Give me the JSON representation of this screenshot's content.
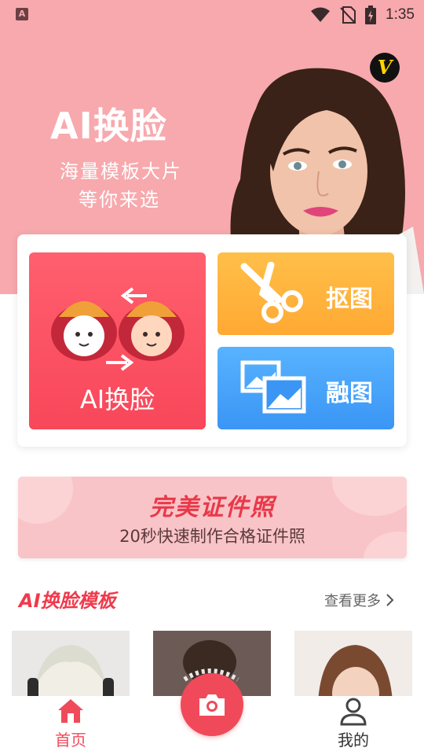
{
  "status_bar": {
    "time": "1:35",
    "app_badge": "A"
  },
  "hero": {
    "title": "AI换脸",
    "subtitle_line1": "海量模板大片",
    "subtitle_line2": "等你来选",
    "vip_badge": "V"
  },
  "features": {
    "face_swap_label": "AI换脸",
    "cutout_label": "抠图",
    "blend_label": "融图"
  },
  "banner": {
    "title": "完美证件照",
    "subtitle": "20秒快速制作合格证件照"
  },
  "templates": {
    "section_title": "AI换脸模板",
    "more_label": "查看更多"
  },
  "bottom_nav": {
    "home_label": "首页",
    "me_label": "我的"
  },
  "colors": {
    "hero_bg": "#f7a9ad",
    "accent_red": "#f04a5a",
    "cutout_orange": "#ffb03a",
    "blend_blue": "#4aa3fa"
  },
  "icons": {
    "wifi": "wifi-icon",
    "no_sim": "no-sim-icon",
    "battery": "battery-charging-icon",
    "scissors": "scissors-icon",
    "images": "images-icon",
    "camera": "camera-icon",
    "home": "home-icon",
    "user": "user-icon"
  }
}
